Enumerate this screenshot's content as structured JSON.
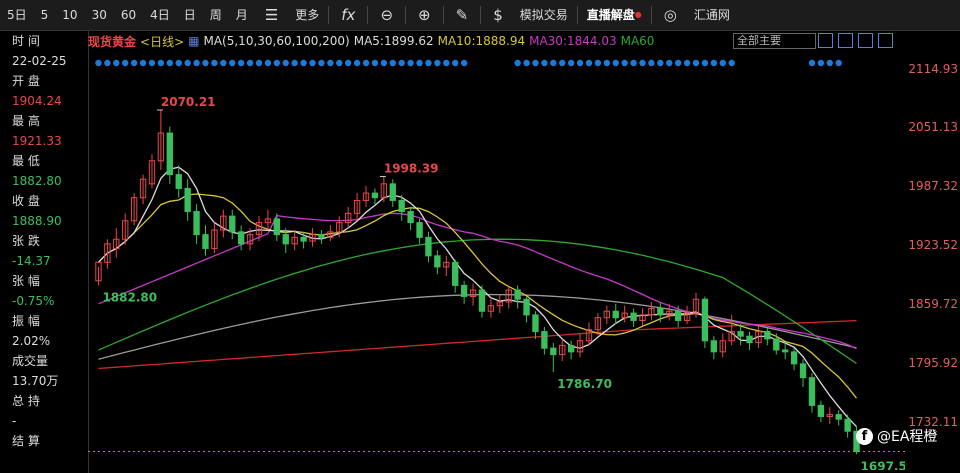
{
  "toolbar": {
    "periods": [
      "5日",
      "5",
      "10",
      "30",
      "60",
      "4日",
      "日",
      "周",
      "月"
    ],
    "more_label": "更多",
    "fx_label": "fx",
    "trade_label": "模拟交易",
    "live_label": "直播解盘",
    "fx678_label": "汇通网"
  },
  "info_panel": [
    {
      "label": "时 间",
      "value": "22-02-25",
      "color": "white"
    },
    {
      "label": "开 盘",
      "value": "1904.24",
      "color": "red"
    },
    {
      "label": "最 高",
      "value": "1921.33",
      "color": "red"
    },
    {
      "label": "最 低",
      "value": "1882.80",
      "color": "green"
    },
    {
      "label": "收 盘",
      "value": "1888.90",
      "color": "green"
    },
    {
      "label": "张 跌",
      "value": "-14.37",
      "color": "green"
    },
    {
      "label": "张 幅",
      "value": "-0.75%",
      "color": "green"
    },
    {
      "label": "振 幅",
      "value": "2.02%",
      "color": "white"
    },
    {
      "label": "成交量",
      "value": "13.70万",
      "color": "white"
    },
    {
      "label": "总 持",
      "value": "-",
      "color": "white"
    }
  ],
  "info_last_label": "结 算",
  "legend": {
    "instrument": "现货黄金",
    "period": "<日线>",
    "ma_params": "MA(5,10,30,60,100,200)",
    "ma5": "MA5:1899.62",
    "ma10": "MA10:1888.94",
    "ma30": "MA30:1844.03",
    "ma60": "MA60"
  },
  "view_select": "全部主要",
  "colors": {
    "up": "#e8484c",
    "down": "#3bbf5c",
    "ma5": "#dddddd",
    "ma10": "#d9c63a",
    "ma30": "#c838c8",
    "ma60": "#2fa82f",
    "ma100": "#9a9a9a",
    "ma200": "#d02a2a",
    "dots": "#1e7ad8"
  },
  "chart_data": {
    "type": "candlestick",
    "title": "现货黄金 日线",
    "y_axis_ticks": [
      "2114.93",
      "2051.13",
      "1987.32",
      "1923.52",
      "1859.72",
      "1795.92",
      "1732.11"
    ],
    "ylim": [
      1680,
      2135
    ],
    "annotations": [
      {
        "text": "2070.21",
        "type": "high"
      },
      {
        "text": "1998.39",
        "type": "high"
      },
      {
        "text": "1882.80",
        "type": "low"
      },
      {
        "text": "1786.70",
        "type": "low"
      },
      {
        "text": "1697.53",
        "type": "low"
      }
    ],
    "last_price_line": 1700,
    "candles": [
      [
        1885,
        1905,
        1900,
        1880
      ],
      [
        1905,
        1925,
        1930,
        1898
      ],
      [
        1920,
        1930,
        1942,
        1910
      ],
      [
        1930,
        1950,
        1958,
        1924
      ],
      [
        1950,
        1975,
        1980,
        1945
      ],
      [
        1975,
        1995,
        2000,
        1968
      ],
      [
        1990,
        2015,
        2022,
        1985
      ],
      [
        2015,
        2045,
        2070,
        2005
      ],
      [
        2045,
        2000,
        2052,
        1990
      ],
      [
        2000,
        1985,
        2010,
        1975
      ],
      [
        1985,
        1960,
        1995,
        1950
      ],
      [
        1960,
        1935,
        1968,
        1925
      ],
      [
        1935,
        1920,
        1945,
        1912
      ],
      [
        1920,
        1940,
        1948,
        1915
      ],
      [
        1940,
        1955,
        1962,
        1932
      ],
      [
        1955,
        1938,
        1962,
        1930
      ],
      [
        1938,
        1925,
        1945,
        1918
      ],
      [
        1925,
        1935,
        1942,
        1918
      ],
      [
        1935,
        1948,
        1955,
        1928
      ],
      [
        1948,
        1952,
        1962,
        1940
      ],
      [
        1952,
        1935,
        1958,
        1928
      ],
      [
        1935,
        1925,
        1942,
        1915
      ],
      [
        1925,
        1932,
        1940,
        1918
      ],
      [
        1932,
        1928,
        1938,
        1920
      ],
      [
        1928,
        1935,
        1942,
        1922
      ],
      [
        1935,
        1932,
        1940,
        1925
      ],
      [
        1932,
        1938,
        1945,
        1928
      ],
      [
        1938,
        1948,
        1955,
        1932
      ],
      [
        1948,
        1958,
        1965,
        1942
      ],
      [
        1958,
        1972,
        1980,
        1950
      ],
      [
        1972,
        1980,
        1988,
        1965
      ],
      [
        1980,
        1975,
        1985,
        1968
      ],
      [
        1975,
        1990,
        1998,
        1970
      ],
      [
        1990,
        1972,
        1995,
        1965
      ],
      [
        1972,
        1960,
        1978,
        1950
      ],
      [
        1960,
        1948,
        1965,
        1940
      ],
      [
        1948,
        1932,
        1952,
        1925
      ],
      [
        1932,
        1912,
        1938,
        1905
      ],
      [
        1912,
        1900,
        1918,
        1892
      ],
      [
        1900,
        1905,
        1912,
        1890
      ],
      [
        1905,
        1880,
        1908,
        1872
      ],
      [
        1880,
        1868,
        1885,
        1860
      ],
      [
        1868,
        1875,
        1882,
        1858
      ],
      [
        1875,
        1852,
        1880,
        1845
      ],
      [
        1852,
        1858,
        1865,
        1845
      ],
      [
        1858,
        1862,
        1870,
        1850
      ],
      [
        1862,
        1875,
        1880,
        1855
      ],
      [
        1875,
        1865,
        1880,
        1855
      ],
      [
        1865,
        1848,
        1868,
        1840
      ],
      [
        1848,
        1830,
        1852,
        1822
      ],
      [
        1830,
        1812,
        1835,
        1805
      ],
      [
        1812,
        1805,
        1818,
        1786
      ],
      [
        1805,
        1815,
        1822,
        1798
      ],
      [
        1815,
        1808,
        1820,
        1800
      ],
      [
        1808,
        1820,
        1828,
        1802
      ],
      [
        1820,
        1832,
        1840,
        1815
      ],
      [
        1832,
        1845,
        1850,
        1826
      ],
      [
        1845,
        1852,
        1858,
        1838
      ],
      [
        1852,
        1845,
        1860,
        1838
      ],
      [
        1845,
        1850,
        1858,
        1840
      ],
      [
        1850,
        1842,
        1855,
        1835
      ],
      [
        1842,
        1848,
        1855,
        1836
      ],
      [
        1848,
        1855,
        1862,
        1842
      ],
      [
        1855,
        1848,
        1862,
        1840
      ],
      [
        1848,
        1852,
        1860,
        1842
      ],
      [
        1852,
        1842,
        1858,
        1835
      ],
      [
        1842,
        1850,
        1858,
        1838
      ],
      [
        1850,
        1865,
        1872,
        1845
      ],
      [
        1865,
        1820,
        1868,
        1812
      ],
      [
        1820,
        1808,
        1825,
        1800
      ],
      [
        1808,
        1820,
        1828,
        1802
      ],
      [
        1820,
        1830,
        1848,
        1815
      ],
      [
        1830,
        1825,
        1838,
        1815
      ],
      [
        1825,
        1818,
        1830,
        1810
      ],
      [
        1818,
        1830,
        1838,
        1812
      ],
      [
        1830,
        1822,
        1835,
        1815
      ],
      [
        1822,
        1810,
        1828,
        1805
      ],
      [
        1810,
        1808,
        1818,
        1800
      ],
      [
        1808,
        1795,
        1812,
        1788
      ],
      [
        1795,
        1780,
        1800,
        1770
      ],
      [
        1780,
        1750,
        1785,
        1742
      ],
      [
        1750,
        1738,
        1755,
        1732
      ],
      [
        1738,
        1740,
        1748,
        1730
      ],
      [
        1740,
        1735,
        1745,
        1728
      ],
      [
        1735,
        1722,
        1740,
        1715
      ],
      [
        1722,
        1700,
        1728,
        1697
      ]
    ]
  }
}
